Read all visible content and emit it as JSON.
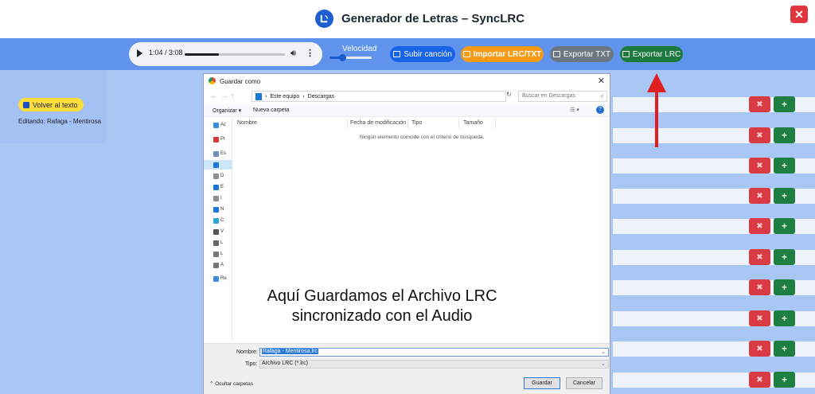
{
  "header": {
    "title": "Generador de Letras – SyncLRC",
    "close_icon": "close-icon",
    "accent": "#e0343e"
  },
  "player": {
    "time": "1:04 / 3:08",
    "progress": 0.34
  },
  "toolbar": {
    "speed_label": "Velocidad",
    "speed_value": 0.3,
    "upload_label": "Subir canción",
    "import_label": "Importar LRC/TXT",
    "export_txt_label": "Exportar TXT",
    "export_lrc_label": "Exportar LRC"
  },
  "left": {
    "back_label": "Volver al texto",
    "editing_label": "Editando: Rafaga - Mentirosa"
  },
  "rows": {
    "count": 10,
    "delete_icon": "delete-icon",
    "add_icon": "add-icon"
  },
  "dialog": {
    "title": "Guardar como",
    "path": [
      "Este equipo",
      "Descargas"
    ],
    "search_placeholder": "Buscar en Descargas",
    "organize_label": "Organizar ▾",
    "new_folder_label": "Nueva carpeta",
    "columns": [
      "Nombre",
      "Fecha de modificación",
      "Tipo",
      "Tamaño"
    ],
    "empty_message": "Ningún elemento coincide con el criterio de búsqueda.",
    "nav_items": [
      "Ac",
      "PI",
      "Es",
      "",
      "D",
      "E",
      "I",
      "N",
      "C",
      "V",
      "L",
      "L",
      "A",
      "Re"
    ],
    "filename_label": "Nombre:",
    "filename_value": "Rafaga - Mentirosa.lrc",
    "type_label": "Tipo:",
    "type_value": "Archivo LRC (*.lrc)",
    "hide_folders_label": "Ocultar carpetas",
    "save_label": "Guardar",
    "cancel_label": "Cancelar"
  },
  "annotation": {
    "line1": "Aquí Guardamos el Archivo LRC",
    "line2": "sincronizado con el Audio",
    "arrow_color": "#e02020"
  }
}
